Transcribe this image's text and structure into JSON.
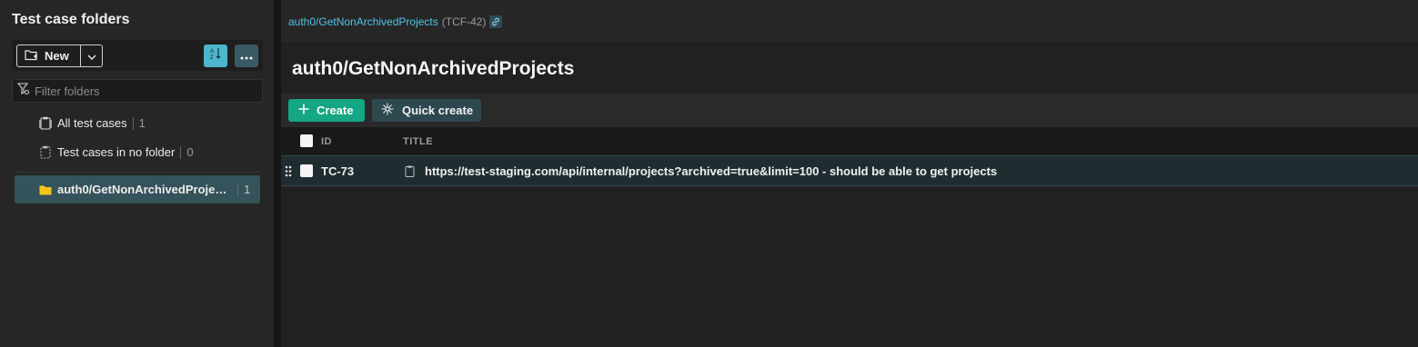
{
  "sidebar": {
    "title": "Test case folders",
    "new_label": "New",
    "filter_placeholder": "Filter folders",
    "items": [
      {
        "label": "All test cases",
        "count": "1"
      },
      {
        "label": "Test cases in no folder",
        "count": "0"
      },
      {
        "label": "auth0/GetNonArchivedProjects",
        "count": "1",
        "selected": true
      }
    ],
    "icons": [
      "new-folder-icon",
      "chevron-down-icon",
      "sort-az-icon",
      "more-icon",
      "filter-icon",
      "clipboard-icon",
      "folder-icon"
    ]
  },
  "main": {
    "breadcrumb_link": "auth0/GetNonArchivedProjects",
    "breadcrumb_key": "(TCF-42)",
    "page_title": "auth0/GetNonArchivedProjects",
    "create_label": "Create",
    "quick_create_label": "Quick create",
    "columns": {
      "id": "ID",
      "title": "TITLE"
    },
    "rows": [
      {
        "id": "TC-73",
        "title": "https://test-staging.com/api/internal/projects?archived=true&limit=100 - should be able to get projects"
      }
    ]
  },
  "colors": {
    "accent": "#4cb6cc",
    "create": "#15a683",
    "selected_bg": "#35535b",
    "link": "#4fc4e6"
  }
}
